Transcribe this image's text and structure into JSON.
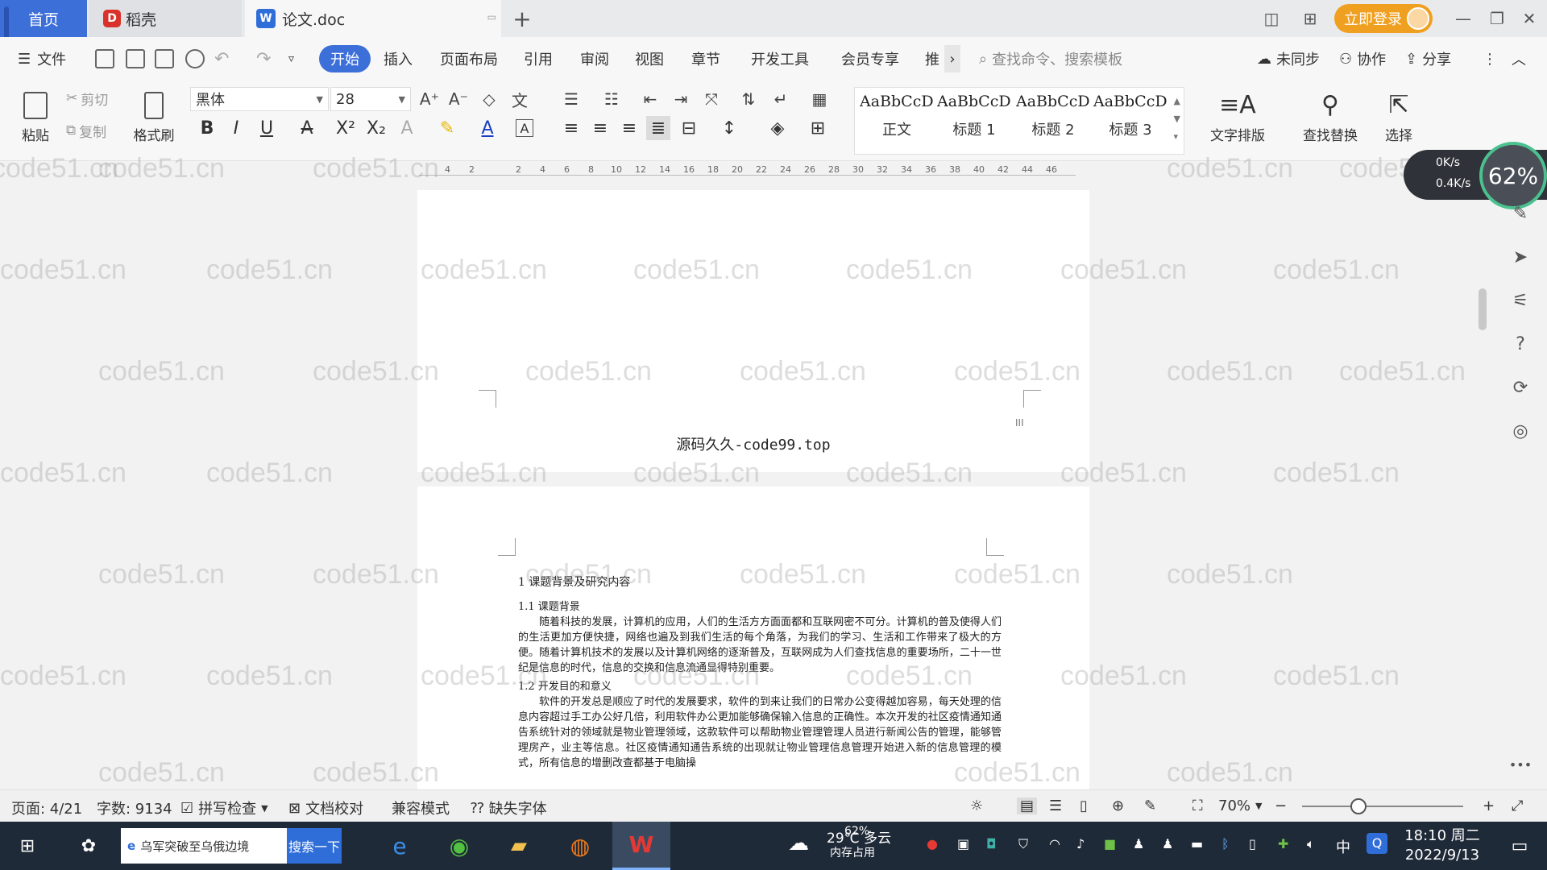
{
  "tabs": {
    "home": "首页",
    "daoke": "稻壳",
    "doc": "论文.doc",
    "add": "+"
  },
  "topbar": {
    "login": "立即登录"
  },
  "menu": {
    "file": "文件",
    "items": [
      "开始",
      "插入",
      "页面布局",
      "引用",
      "审阅",
      "视图",
      "章节",
      "开发工具",
      "会员专享",
      "推"
    ],
    "more": "›",
    "search_cmd": "查找命令、搜索模板",
    "unsynced": "未同步",
    "collab": "协作",
    "share": "分享"
  },
  "ribbon": {
    "paste": "粘贴",
    "cut": "剪切",
    "copy": "复制",
    "format_painter": "格式刷",
    "font": "黑体",
    "size": "28",
    "styles": [
      {
        "preview": "AaBbCcDd",
        "name": "正文"
      },
      {
        "preview": "AaBbCcDd",
        "name": "标题 1"
      },
      {
        "preview": "AaBbCcDd",
        "name": "标题 2"
      },
      {
        "preview": "AaBbCcDd",
        "name": "标题 3"
      }
    ],
    "text_layout": "文字排版",
    "find_replace": "查找替换",
    "select": "选择"
  },
  "ruler": [
    "4",
    "2",
    "2",
    "4",
    "6",
    "8",
    "10",
    "12",
    "14",
    "16",
    "18",
    "20",
    "22",
    "24",
    "26",
    "28",
    "30",
    "32",
    "34",
    "36",
    "38",
    "40",
    "42",
    "44",
    "46"
  ],
  "network": {
    "up": "0K/s",
    "down": "0.4K/s",
    "percent": "62%"
  },
  "page1": {
    "footer": "源码久久-code99.top",
    "page_num": "III"
  },
  "page2": {
    "h1": "1 课题背景及研究内容",
    "h2a": "1.1 课题背景",
    "p1": "随着科技的发展，计算机的应用，人们的生活方方面面都和互联网密不可分。计算机的普及使得人们的生活更加方便快捷，网络也遍及到我们生活的每个角落，为我们的学习、生活和工作带来了极大的方便。随着计算机技术的发展以及计算机网络的逐渐普及，互联网成为人们查找信息的重要场所，二十一世纪是信息的时代，信息的交换和信息流通显得特别重要。",
    "h2b": "1.2 开发目的和意义",
    "p2": "软件的开发总是顺应了时代的发展要求，软件的到来让我们的日常办公变得越加容易，每天处理的信息内容超过手工办公好几倍，利用软件办公更加能够确保输入信息的正确性。本次开发的社区疫情通知通告系统针对的领域就是物业管理领域，这款软件可以帮助物业管理管理人员进行新闻公告的管理，能够管理房产，业主等信息。社区疫情通知通告系统的出现就让物业管理信息管理开始进入新的信息管理的模式，所有信息的增删改查都基于电脑操"
  },
  "watermark": "code51.cn",
  "statusbar": {
    "page": "页面: 4/21",
    "words": "字数: 9134",
    "spell": "拼写检查",
    "proof": "文档校对",
    "compat": "兼容模式",
    "missing_font": "缺失字体",
    "zoom": "70%"
  },
  "taskbar": {
    "search_text": "乌军突破至乌俄边境",
    "search_btn": "搜索一下",
    "weather_temp": "29℃ 多云",
    "mem": "62%",
    "mem_label": "内存占用",
    "ime": "中",
    "time": "18:10 周二",
    "date": "2022/9/13"
  }
}
